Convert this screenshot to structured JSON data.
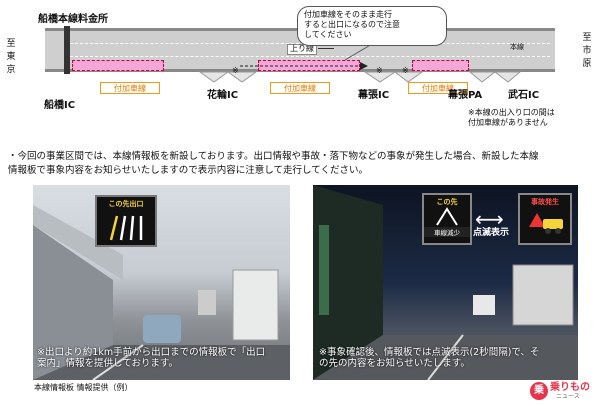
{
  "diagram": {
    "toll_gate": "船橋本線料金所",
    "left_direction": "至\n東京",
    "right_direction": "至\n市原",
    "up_line": "上り線",
    "main_line": "本線",
    "callout": "付加車線をそのまま走行\nすると出口になるので注意\nしてください",
    "added_lane_labels": [
      "付加車線",
      "付加車線",
      "付加車線"
    ],
    "interchanges": [
      "船橋IC",
      "花輪IC",
      "幕張IC",
      "幕張PA",
      "武石IC"
    ],
    "note": "※本線の出入り口の間は\n付加車線がありません"
  },
  "bullet_text": "・今回の事業区間では、本線情報板を新設しております。出口情報や事故・落下物などの事象が発生した場合、新設した本線\n情報板で事象内容をお知らせいたしますので表示内容に注意して走行してください。",
  "photo_left": {
    "sign": "この先出口",
    "caption": "※出口より約1km手前から出口までの情報板で「出口\n案内」情報を提供しております。"
  },
  "photo_right": {
    "sign_left_title": "この先",
    "sign_left_sub": "車線減少",
    "sign_right_title": "事故発生",
    "blink": "点滅表示",
    "caption": "※事象確認後、情報板では点滅表示(2秒間隔)で、そ\nの先の内容をお知らせいたします。"
  },
  "figure_caption": "本線情報板 情報提供（例）",
  "watermark": {
    "brand": "乗りもの",
    "sub": "ニュース"
  },
  "colors": {
    "orange": "#f39a16",
    "pink": "#f4a7d8",
    "road": "#c9c9c9"
  }
}
